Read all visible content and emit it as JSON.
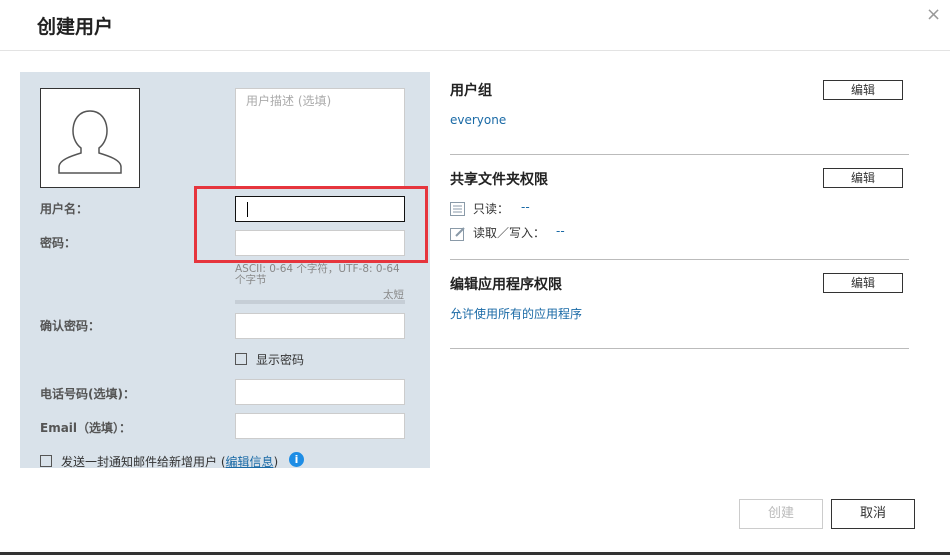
{
  "dialog": {
    "title": "创建用户",
    "close_icon": "×"
  },
  "form": {
    "description_placeholder": "用户描述 (选填)",
    "username_label": "用户名：",
    "password_label": "密码：",
    "password_hint": "ASCII: 0-64 个字符，UTF-8: 0-64 个字节",
    "strength_label": "太短",
    "confirm_label": "确认密码：",
    "show_password": "显示密码",
    "phone_label": "电话号码(选填)：",
    "email_label": "Email（选填）：",
    "notify_text": "发送一封通知邮件给新增用户 (",
    "notify_link": "编辑信息",
    "notify_close": ")",
    "info_icon": "i"
  },
  "right": {
    "group": {
      "title": "用户组",
      "edit": "编辑",
      "value": "everyone"
    },
    "share": {
      "title": "共享文件夹权限",
      "edit": "编辑",
      "readonly_label": "只读：",
      "readonly_value": "--",
      "rw_label": "读取／写入：",
      "rw_value": "--"
    },
    "apps": {
      "title": "编辑应用程序权限",
      "edit": "编辑",
      "value": "允许使用所有的应用程序"
    }
  },
  "footer": {
    "create": "创建",
    "cancel": "取消"
  }
}
